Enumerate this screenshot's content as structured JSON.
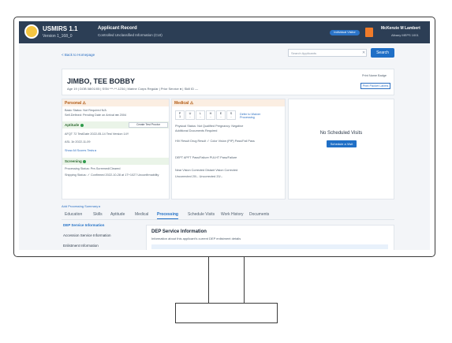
{
  "app": {
    "name": "USMIRS 1.1",
    "version": "Version 1_168_0",
    "title": "Applicant Record",
    "subtitle": "Controlled Unclassified Information (CUI)",
    "env_badge": "Individual Visitor",
    "user_name": "McKenzie M Lambert",
    "user_org": "Albany MEPS 1001"
  },
  "nav": {
    "back_link": "< Back to Homepage",
    "search_placeholder": "Search Applicants",
    "search_clear": "✕",
    "search_button": "Search"
  },
  "applicant": {
    "name": "JIMBO, TEE BOBBY",
    "meta": "Age 19 | DOB 08/01/05 | SSN ***-**-1234 | Marine Corps Regular | Prior Service ● | Skill ID —",
    "print_badge": "Print Name Badge",
    "print_packet": "Print Packet Labels"
  },
  "personal": {
    "header": "Personal ⚠",
    "rows": [
      "Basic Status: Not Required   N/A",
      "Self-Defined: Pending        Date on Arrival   ●● 2004"
    ],
    "aptitude_header": "Aptitude",
    "aptitude_btn": "Create Test Proctor",
    "test_row": "AFQT 72     TestDate 2022-05-14     Test Version 14Y",
    "test_row2": "ASL 1b     2022-11-09",
    "show_all": "Show All Scores Tests ▸",
    "screening_header": "Screening",
    "screening_rows": [
      "Processing Status: Pre-Screened/Cleared",
      "Shipping Status: ✓ Confirmed 2022-10-28 at 1T+1027 Unconfirmability"
    ]
  },
  "medical": {
    "header": "Medical ⚠",
    "pulhes_labels": [
      "P",
      "U",
      "L",
      "H",
      "E",
      "S"
    ],
    "pulhes_values": [
      "1",
      "-",
      "-",
      "-",
      "-",
      "-"
    ],
    "defer_label": "Defer to Waiver Processing",
    "rows": [
      "Physical Status: Not Qualified   Pregnancy: Negative",
      "Additional Documents Required",
      "HIV Result     Drug Result ✓     Color Vision (PIP)  Pass/Fail Pass",
      "DEPT    APFT  Pass/Failure    PULHT  Pass/Failure",
      "Near Vision     Corrected     Distant Vision     Corrected",
      "Uncorrected  20/--  Uncorrected  20/--"
    ]
  },
  "visits": {
    "title": "No Scheduled Visits",
    "schedule_button": "Schedule a Visit"
  },
  "add_processing": "Add Processing Summary ▸",
  "tabs": [
    "Education",
    "Skills",
    "Aptitude",
    "Medical",
    "Processing",
    "Schedule Visits",
    "Work History",
    "Documents"
  ],
  "active_tab": "Processing",
  "side_nav": {
    "items": [
      "DEP Service Information",
      "Accession Service Information",
      "Enlistment Information"
    ],
    "active": "DEP Service Information"
  },
  "content": {
    "title": "DEP Service Information",
    "description": "Information about this applicant's current DEP enlistment details"
  }
}
